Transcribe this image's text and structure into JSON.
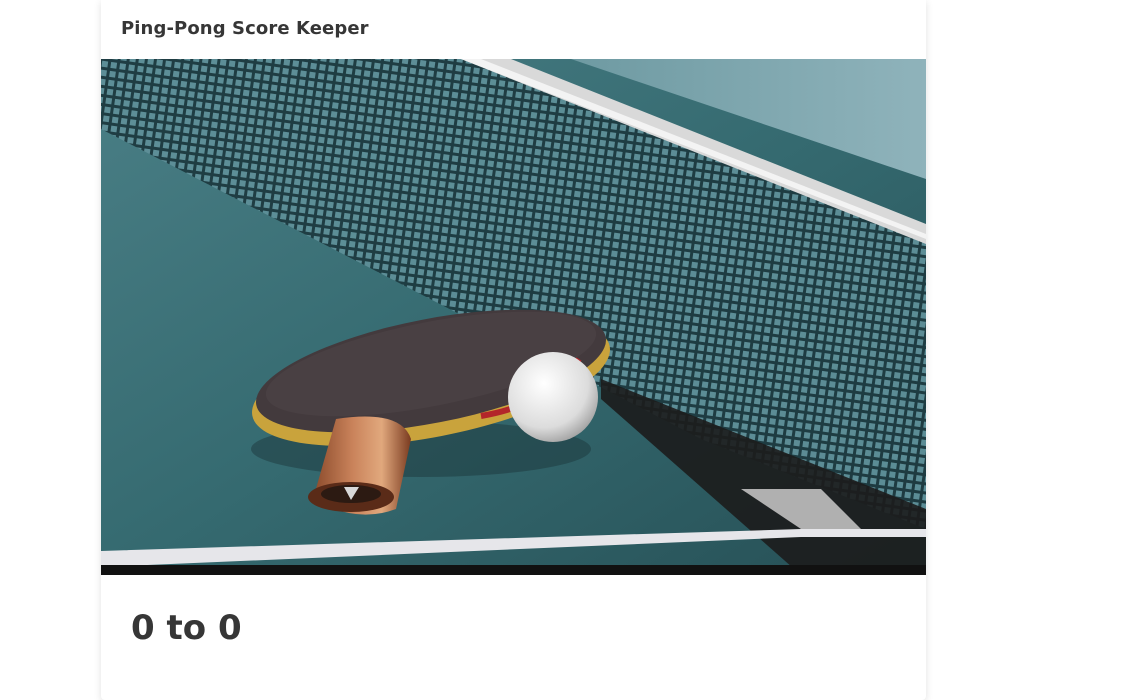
{
  "card": {
    "title": "Ping-Pong Score Keeper",
    "image_alt": "ping-pong paddle, ball and net on a table",
    "score": {
      "text": "0 to 0",
      "player1": 0,
      "player2": 0
    }
  }
}
